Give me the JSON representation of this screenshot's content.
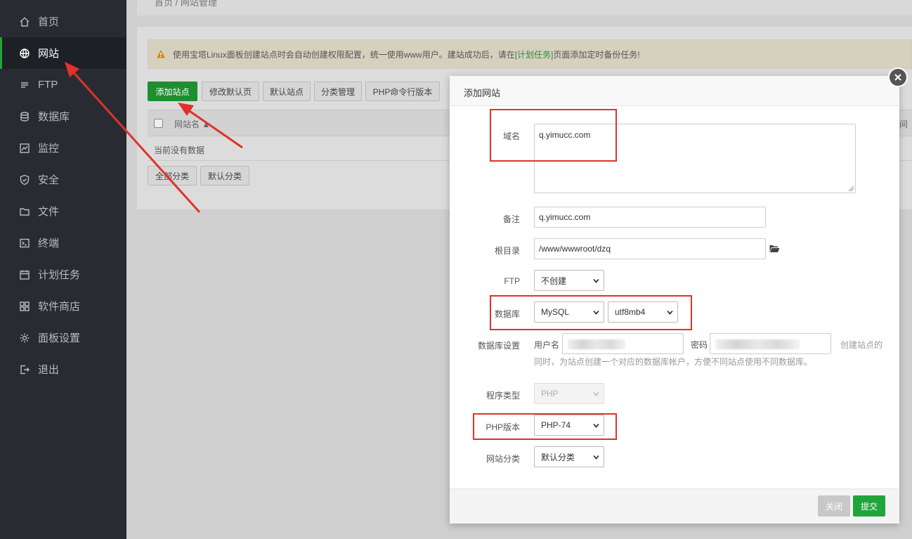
{
  "sidebar": {
    "items": [
      {
        "label": "首页",
        "icon": "home-icon"
      },
      {
        "label": "网站",
        "icon": "globe-icon"
      },
      {
        "label": "FTP",
        "icon": "ftp-icon"
      },
      {
        "label": "数据库",
        "icon": "database-icon"
      },
      {
        "label": "监控",
        "icon": "monitor-icon"
      },
      {
        "label": "安全",
        "icon": "shield-icon"
      },
      {
        "label": "文件",
        "icon": "folder-icon"
      },
      {
        "label": "终端",
        "icon": "terminal-icon"
      },
      {
        "label": "计划任务",
        "icon": "calendar-icon"
      },
      {
        "label": "软件商店",
        "icon": "apps-icon"
      },
      {
        "label": "面板设置",
        "icon": "gear-icon"
      },
      {
        "label": "退出",
        "icon": "logout-icon"
      }
    ],
    "active_index": 1
  },
  "breadcrumb": {
    "text": "首页 / 网站管理"
  },
  "notice": {
    "prefix": "使用宝塔Linux面板创建站点时会自动创建权限配置，统一使用www用户。建站成功后，请在",
    "link": "[计划任务]",
    "suffix": "页面添加定时备份任务!"
  },
  "toolbar": {
    "add_site": "添加站点",
    "modify_default_page": "修改默认页",
    "default_site": "默认站点",
    "category_manage": "分类管理",
    "php_cli_version": "PHP命令行版本"
  },
  "table": {
    "col_name": "网站名",
    "col_right": "间",
    "empty_text": "当前没有数据"
  },
  "filters": {
    "all": "全部分类",
    "default": "默认分类"
  },
  "modal": {
    "title": "添加网站",
    "domain_label": "域名",
    "domain_value": "q.yimucc.com",
    "remark_label": "备注",
    "remark_value": "q.yimucc.com",
    "root_label": "根目录",
    "root_value": "/www/wwwroot/dzq",
    "ftp_label": "FTP",
    "ftp_value": "不创建",
    "db_label": "数据库",
    "db_type": "MySQL",
    "db_charset": "utf8mb4",
    "db_settings_label": "数据库设置",
    "db_user_label": "用户名",
    "db_pass_label": "密码",
    "db_hint_line1": "创建站点的",
    "db_hint_line2": "同时，为站点创建一个对应的数据库帐户，方便不同站点使用不同数据库。",
    "program_label": "程序类型",
    "program_value": "PHP",
    "php_label": "PHP版本",
    "php_value": "PHP-74",
    "category_label": "网站分类",
    "category_value": "默认分类",
    "close_btn": "关闭",
    "submit_btn": "提交"
  },
  "colors": {
    "accent": "#20a53a",
    "annotation": "#e0322a",
    "sidebar_bg": "#282c32"
  }
}
